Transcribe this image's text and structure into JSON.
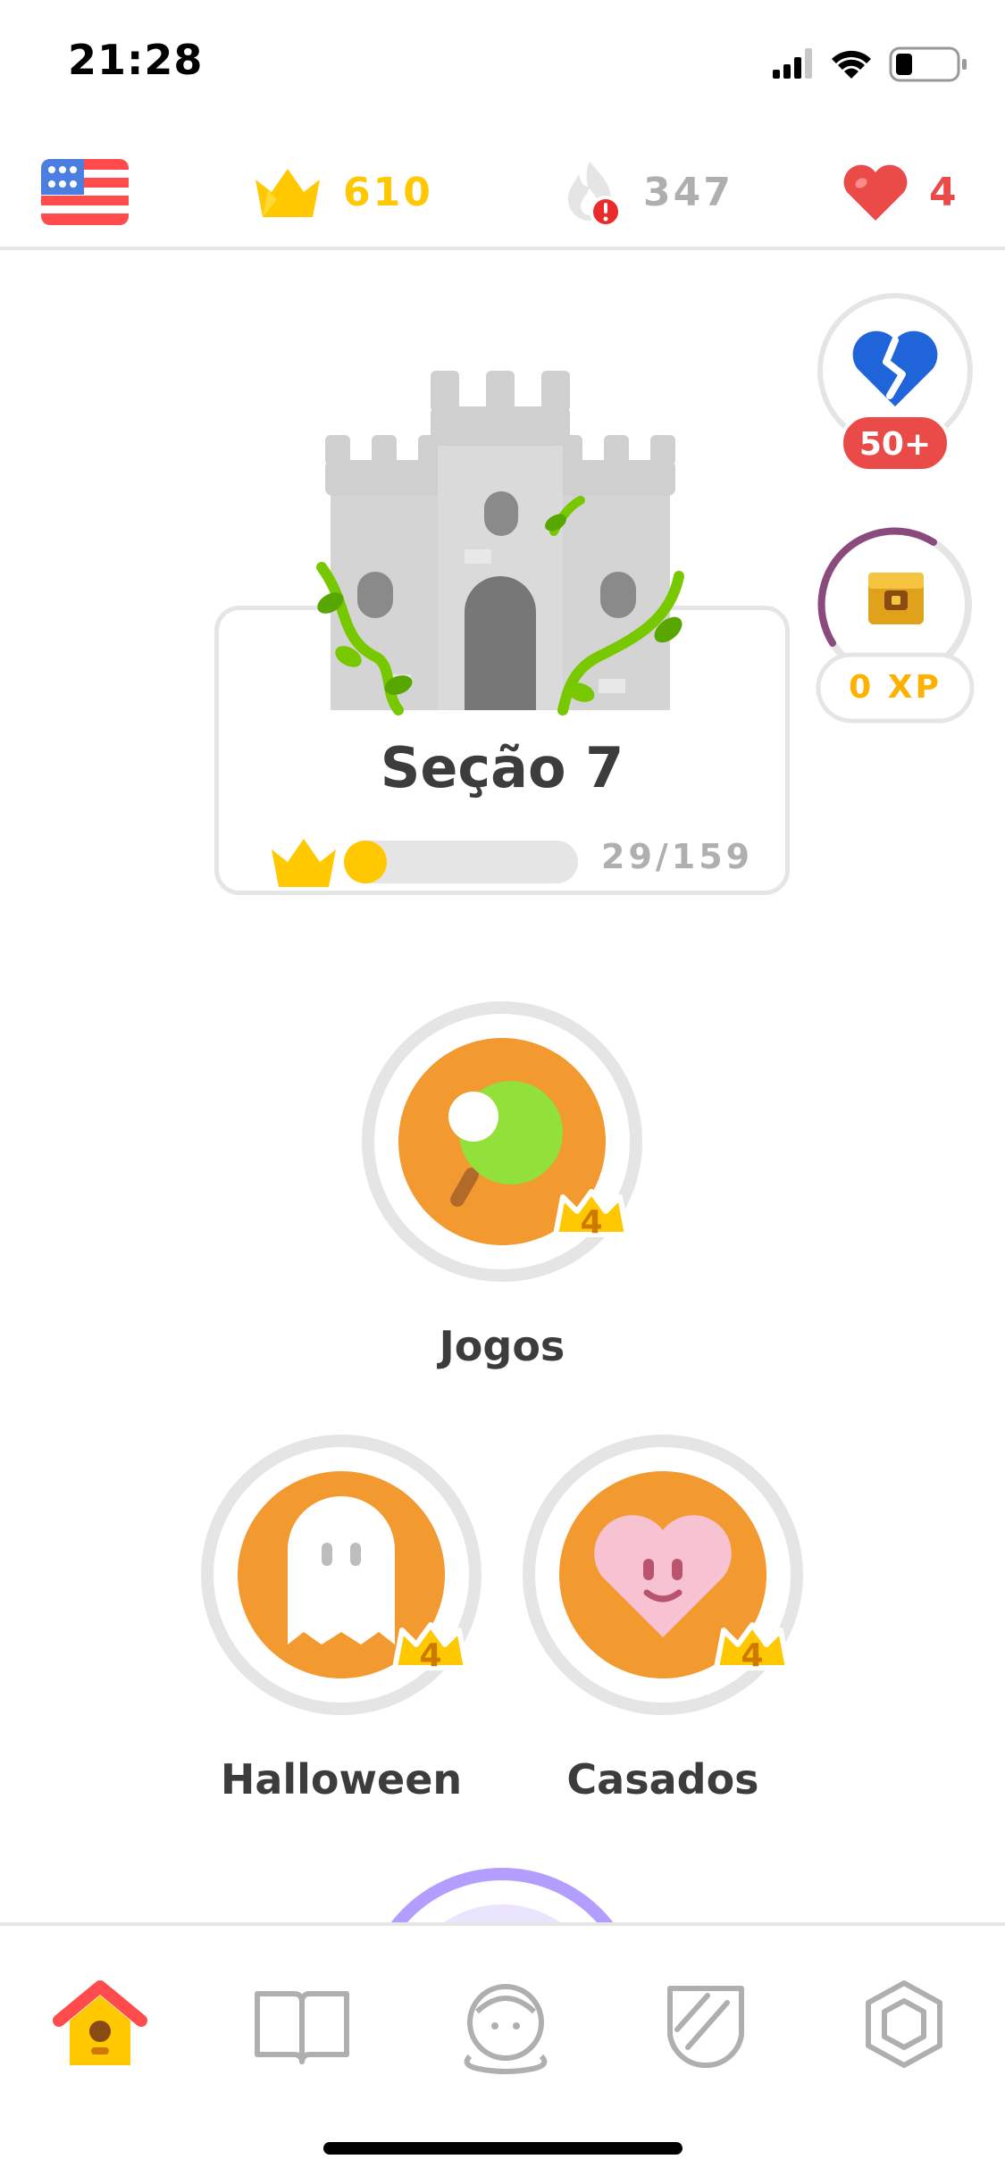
{
  "status_bar": {
    "time": "21:28",
    "icons": [
      "signal-icon",
      "wifi-icon",
      "battery-icon"
    ]
  },
  "top_bar": {
    "flag": "us-flag-icon",
    "crowns": "610",
    "streak": "347",
    "hearts": "4"
  },
  "side_panel": {
    "repair_badge": "50+",
    "xp_label": "0 XP"
  },
  "section": {
    "title": "Seção 7",
    "progress_text": "29/159",
    "progress_value": 29,
    "progress_max": 159
  },
  "skills": [
    {
      "label": "Jogos",
      "crown_level": "4",
      "icon": "ping-pong-paddle-icon"
    },
    {
      "label": "Halloween",
      "crown_level": "4",
      "icon": "ghost-icon"
    },
    {
      "label": "Casados",
      "crown_level": "4",
      "icon": "heart-face-icon"
    }
  ],
  "tabs": [
    {
      "name": "home",
      "icon": "home-icon"
    },
    {
      "name": "stories",
      "icon": "book-icon"
    },
    {
      "name": "profile",
      "icon": "profile-avatar-icon"
    },
    {
      "name": "leagues",
      "icon": "shield-icon"
    },
    {
      "name": "shop",
      "icon": "gem-icon"
    }
  ],
  "colors": {
    "gold": "#ffc800",
    "orange": "#f29930",
    "red": "#ea4b48",
    "grey": "#e5e5e5",
    "text_dark": "#3c3c3c",
    "text_grey": "#afafaf",
    "purple": "#8b4a7c"
  }
}
